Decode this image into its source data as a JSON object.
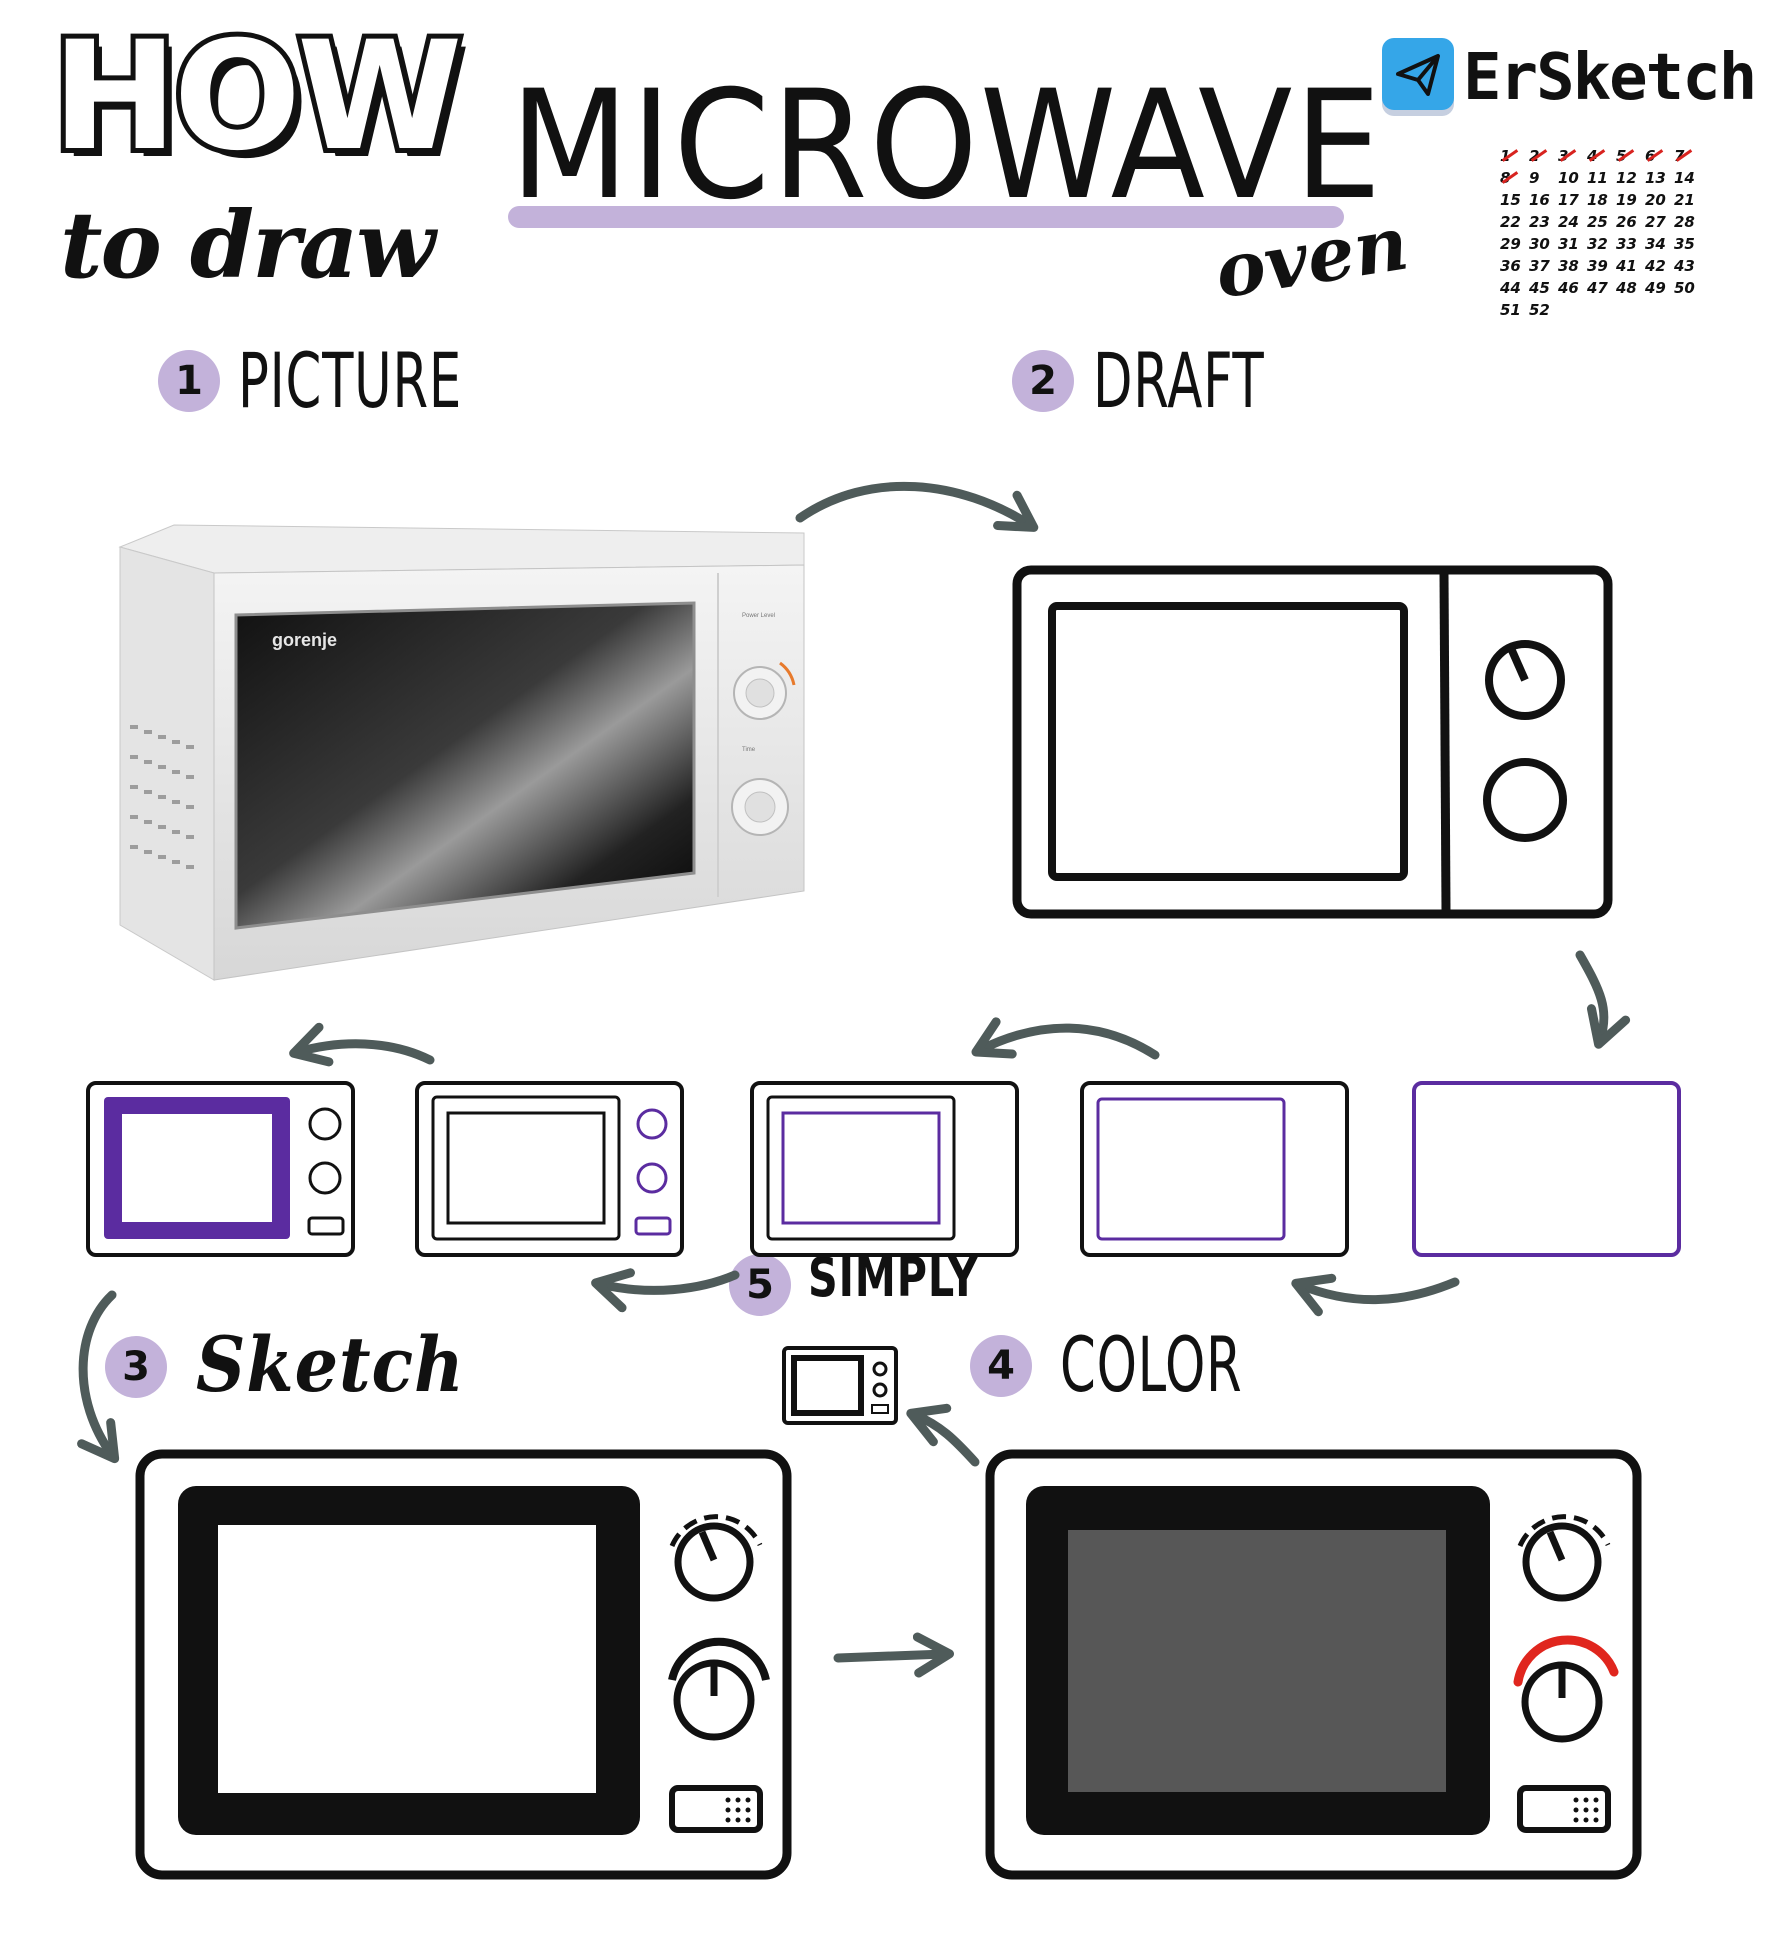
{
  "header": {
    "how": "HOW",
    "to_draw": "to draw",
    "title": "MICROWAVE",
    "subtitle": "oven"
  },
  "brand": {
    "name": "ErSketch",
    "icon": "telegram-paper-plane-icon"
  },
  "calendar": {
    "rows": [
      [
        "1",
        "2",
        "3",
        "4",
        "5",
        "6",
        "7"
      ],
      [
        "8",
        "9",
        "10",
        "11",
        "12",
        "13",
        "14"
      ],
      [
        "15",
        "16",
        "17",
        "18",
        "19",
        "20",
        "21"
      ],
      [
        "22",
        "23",
        "24",
        "25",
        "26",
        "27",
        "28"
      ],
      [
        "29",
        "30",
        "31",
        "32",
        "33",
        "34",
        "35"
      ],
      [
        "36",
        "37",
        "38",
        "39",
        "41",
        "42",
        "43"
      ],
      [
        "44",
        "45",
        "46",
        "47",
        "48",
        "49",
        "50"
      ],
      [
        "51",
        "52"
      ]
    ],
    "crossed_out": [
      "1",
      "2",
      "3",
      "4",
      "5",
      "6",
      "7",
      "8"
    ],
    "cross_color": "#d8231f"
  },
  "photo": {
    "brand_label": "gorenje",
    "dial_1_label": "Power Level",
    "dial_2_label": "Time"
  },
  "steps": [
    {
      "number": "1",
      "label": "PICTURE"
    },
    {
      "number": "2",
      "label": "DRAFT"
    },
    {
      "number": "3",
      "label": "Sketch"
    },
    {
      "number": "4",
      "label": "COLOR"
    },
    {
      "number": "5",
      "label": "SIMPLY"
    }
  ],
  "colors": {
    "accent_purple": "#c3b2da",
    "line_purple": "#5b2ca0",
    "arrow_gray": "#4f5b5a",
    "screen_gray": "#575757",
    "dial_red": "#e0261e"
  }
}
